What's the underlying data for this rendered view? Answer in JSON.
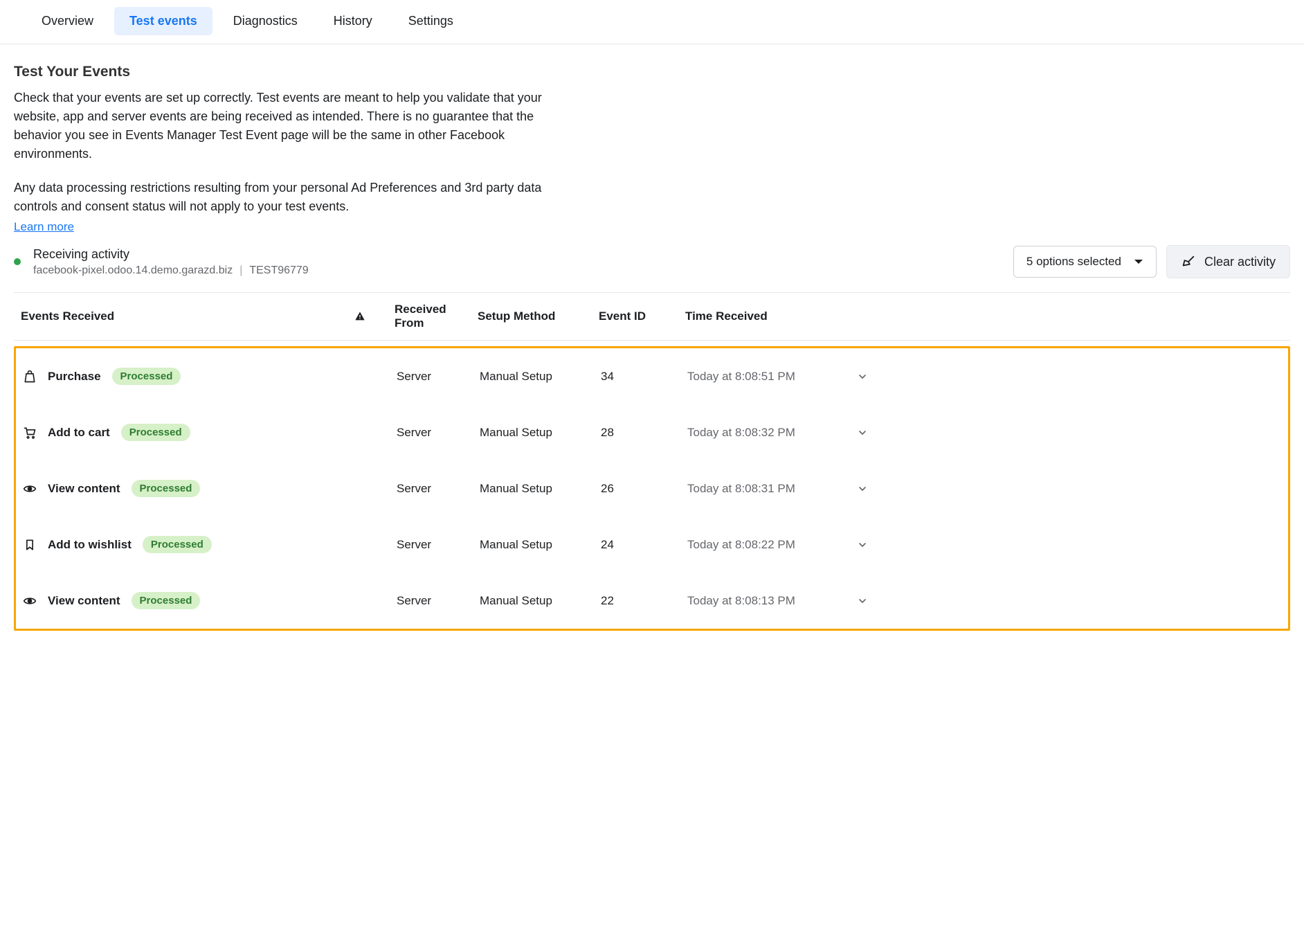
{
  "tabs": {
    "items": [
      "Overview",
      "Test events",
      "Diagnostics",
      "History",
      "Settings"
    ],
    "active": "Test events"
  },
  "heading": "Test Your Events",
  "desc1": "Check that your events are set up correctly. Test events are meant to help you validate that your website, app and server events are being received as intended. There is no guarantee that the behavior you see in Events Manager Test Event page will be the same in other Facebook environments.",
  "desc2": "Any data processing restrictions resulting from your personal Ad Preferences and 3rd party data controls and consent status will not apply to your test events.",
  "learn": "Learn more",
  "activity": {
    "title": "Receiving activity",
    "domain": "facebook-pixel.odoo.14.demo.garazd.biz",
    "code": "TEST96779"
  },
  "controls": {
    "dropdown": "5 options selected",
    "clear": "Clear activity"
  },
  "table": {
    "headers": {
      "events": "Events Received",
      "from": "Received From",
      "method": "Setup Method",
      "id": "Event ID",
      "time": "Time Received"
    },
    "rows": [
      {
        "icon": "bag",
        "name": "Purchase",
        "status": "Processed",
        "from": "Server",
        "method": "Manual Setup",
        "id": "34",
        "time": "Today at 8:08:51 PM"
      },
      {
        "icon": "cart",
        "name": "Add to cart",
        "status": "Processed",
        "from": "Server",
        "method": "Manual Setup",
        "id": "28",
        "time": "Today at 8:08:32 PM"
      },
      {
        "icon": "eye",
        "name": "View content",
        "status": "Processed",
        "from": "Server",
        "method": "Manual Setup",
        "id": "26",
        "time": "Today at 8:08:31 PM"
      },
      {
        "icon": "bookmark",
        "name": "Add to wishlist",
        "status": "Processed",
        "from": "Server",
        "method": "Manual Setup",
        "id": "24",
        "time": "Today at 8:08:22 PM"
      },
      {
        "icon": "eye",
        "name": "View content",
        "status": "Processed",
        "from": "Server",
        "method": "Manual Setup",
        "id": "22",
        "time": "Today at 8:08:13 PM"
      }
    ]
  }
}
